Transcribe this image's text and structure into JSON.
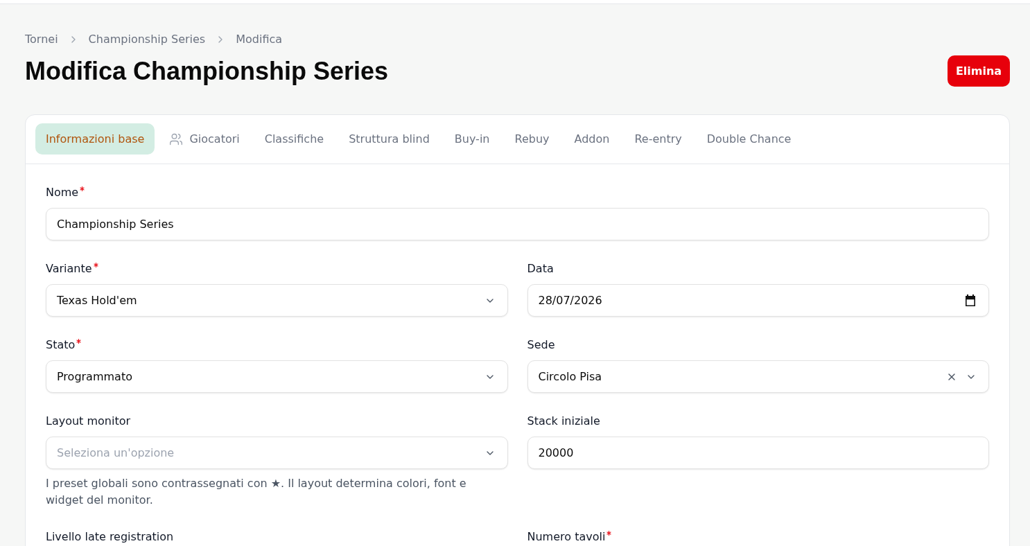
{
  "breadcrumb": [
    {
      "label": "Tornei"
    },
    {
      "label": "Championship Series"
    },
    {
      "label": "Modifica"
    }
  ],
  "title": "Modifica Championship Series",
  "delete_button": {
    "label": "Elimina"
  },
  "tabs": [
    {
      "label": "Informazioni base",
      "selected": true,
      "kind": "text"
    },
    {
      "label": "Giocatori",
      "selected": false,
      "kind": "icon"
    },
    {
      "label": "Classifiche",
      "selected": false,
      "kind": "text"
    },
    {
      "label": "Struttura blind",
      "selected": false,
      "kind": "text"
    },
    {
      "label": "Buy-in",
      "selected": false,
      "kind": "text"
    },
    {
      "label": "Rebuy",
      "selected": false,
      "kind": "text"
    },
    {
      "label": "Addon",
      "selected": false,
      "kind": "text"
    },
    {
      "label": "Re-entry",
      "selected": false,
      "kind": "text"
    },
    {
      "label": "Double Chance",
      "selected": false,
      "kind": "text"
    }
  ],
  "form": {
    "rows": [
      [
        {
          "label": "Nome",
          "required": true,
          "kind": "text",
          "value": "Championship Series"
        }
      ],
      [
        {
          "label": "Variante",
          "required": true,
          "kind": "select",
          "value": "Texas Hold'em",
          "clearable": false
        },
        {
          "label": "Data",
          "required": false,
          "kind": "date",
          "value": "28/07/2026"
        }
      ],
      [
        {
          "label": "Stato",
          "required": true,
          "kind": "select",
          "value": "Programmato",
          "clearable": false
        },
        {
          "label": "Sede",
          "required": false,
          "kind": "select",
          "value": "Circolo Pisa",
          "clearable": true
        }
      ],
      [
        {
          "label": "Layout monitor",
          "required": false,
          "kind": "select",
          "placeholder": "Seleziona un'opzione",
          "clearable": false,
          "help": "I preset globali sono contrassegnati con ★. Il layout determina colori, font e widget del monitor."
        },
        {
          "label": "Stack iniziale",
          "required": false,
          "kind": "text",
          "value": "20000"
        }
      ],
      [
        {
          "label": "Livello late registration",
          "required": false,
          "kind": "label_only"
        },
        {
          "label": "Numero tavoli",
          "required": true,
          "kind": "label_only"
        }
      ]
    ]
  }
}
